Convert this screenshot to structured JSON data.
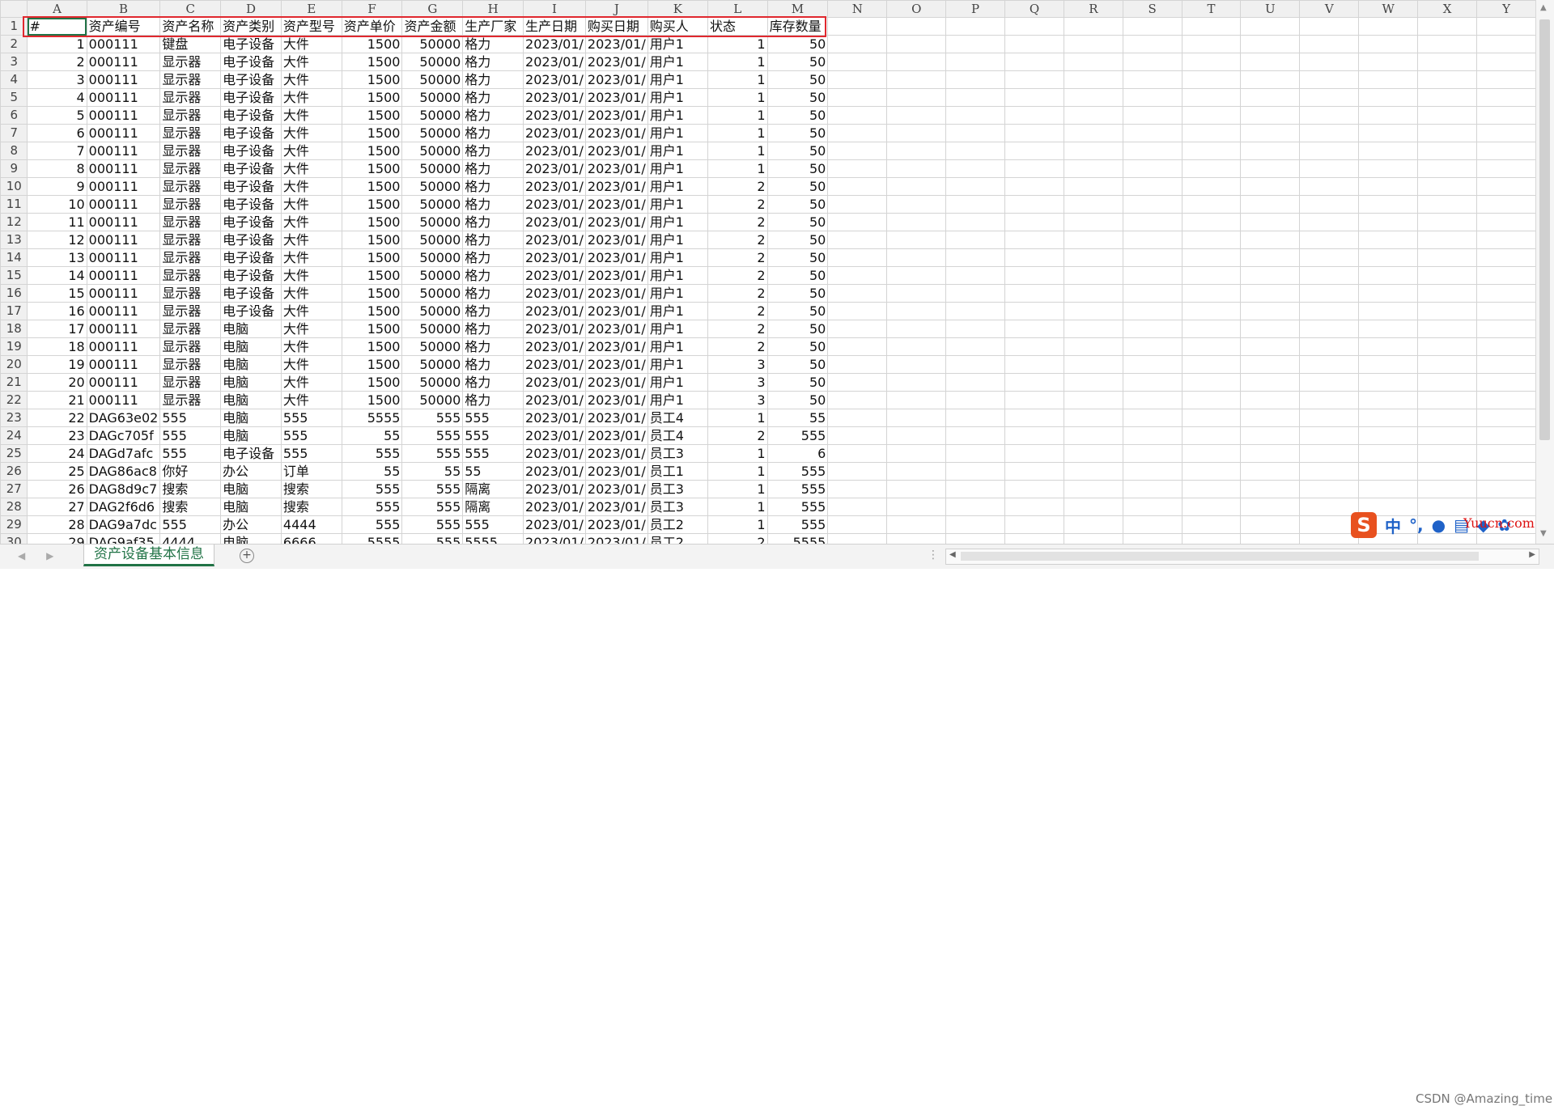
{
  "columns": [
    "A",
    "B",
    "C",
    "D",
    "E",
    "F",
    "G",
    "H",
    "I",
    "J",
    "K",
    "L",
    "M",
    "N",
    "O",
    "P",
    "Q",
    "R",
    "S",
    "T",
    "U",
    "V",
    "W",
    "X",
    "Y"
  ],
  "header_row": [
    "#",
    "资产编号",
    "资产名称",
    "资产类别",
    "资产型号",
    "资产单价",
    "资产金额",
    "生产厂家",
    "生产日期",
    "购买日期",
    "购买人",
    "状态",
    "库存数量"
  ],
  "rows": [
    [
      "1",
      "000111",
      "键盘",
      "电子设备",
      "大件",
      "1500",
      "50000",
      "格力",
      "2023/01/",
      "2023/01/",
      "用户1",
      "1",
      "50"
    ],
    [
      "2",
      "000111",
      "显示器",
      "电子设备",
      "大件",
      "1500",
      "50000",
      "格力",
      "2023/01/",
      "2023/01/",
      "用户1",
      "1",
      "50"
    ],
    [
      "3",
      "000111",
      "显示器",
      "电子设备",
      "大件",
      "1500",
      "50000",
      "格力",
      "2023/01/",
      "2023/01/",
      "用户1",
      "1",
      "50"
    ],
    [
      "4",
      "000111",
      "显示器",
      "电子设备",
      "大件",
      "1500",
      "50000",
      "格力",
      "2023/01/",
      "2023/01/",
      "用户1",
      "1",
      "50"
    ],
    [
      "5",
      "000111",
      "显示器",
      "电子设备",
      "大件",
      "1500",
      "50000",
      "格力",
      "2023/01/",
      "2023/01/",
      "用户1",
      "1",
      "50"
    ],
    [
      "6",
      "000111",
      "显示器",
      "电子设备",
      "大件",
      "1500",
      "50000",
      "格力",
      "2023/01/",
      "2023/01/",
      "用户1",
      "1",
      "50"
    ],
    [
      "7",
      "000111",
      "显示器",
      "电子设备",
      "大件",
      "1500",
      "50000",
      "格力",
      "2023/01/",
      "2023/01/",
      "用户1",
      "1",
      "50"
    ],
    [
      "8",
      "000111",
      "显示器",
      "电子设备",
      "大件",
      "1500",
      "50000",
      "格力",
      "2023/01/",
      "2023/01/",
      "用户1",
      "1",
      "50"
    ],
    [
      "9",
      "000111",
      "显示器",
      "电子设备",
      "大件",
      "1500",
      "50000",
      "格力",
      "2023/01/",
      "2023/01/",
      "用户1",
      "2",
      "50"
    ],
    [
      "10",
      "000111",
      "显示器",
      "电子设备",
      "大件",
      "1500",
      "50000",
      "格力",
      "2023/01/",
      "2023/01/",
      "用户1",
      "2",
      "50"
    ],
    [
      "11",
      "000111",
      "显示器",
      "电子设备",
      "大件",
      "1500",
      "50000",
      "格力",
      "2023/01/",
      "2023/01/",
      "用户1",
      "2",
      "50"
    ],
    [
      "12",
      "000111",
      "显示器",
      "电子设备",
      "大件",
      "1500",
      "50000",
      "格力",
      "2023/01/",
      "2023/01/",
      "用户1",
      "2",
      "50"
    ],
    [
      "13",
      "000111",
      "显示器",
      "电子设备",
      "大件",
      "1500",
      "50000",
      "格力",
      "2023/01/",
      "2023/01/",
      "用户1",
      "2",
      "50"
    ],
    [
      "14",
      "000111",
      "显示器",
      "电子设备",
      "大件",
      "1500",
      "50000",
      "格力",
      "2023/01/",
      "2023/01/",
      "用户1",
      "2",
      "50"
    ],
    [
      "15",
      "000111",
      "显示器",
      "电子设备",
      "大件",
      "1500",
      "50000",
      "格力",
      "2023/01/",
      "2023/01/",
      "用户1",
      "2",
      "50"
    ],
    [
      "16",
      "000111",
      "显示器",
      "电子设备",
      "大件",
      "1500",
      "50000",
      "格力",
      "2023/01/",
      "2023/01/",
      "用户1",
      "2",
      "50"
    ],
    [
      "17",
      "000111",
      "显示器",
      "电脑",
      "大件",
      "1500",
      "50000",
      "格力",
      "2023/01/",
      "2023/01/",
      "用户1",
      "2",
      "50"
    ],
    [
      "18",
      "000111",
      "显示器",
      "电脑",
      "大件",
      "1500",
      "50000",
      "格力",
      "2023/01/",
      "2023/01/",
      "用户1",
      "2",
      "50"
    ],
    [
      "19",
      "000111",
      "显示器",
      "电脑",
      "大件",
      "1500",
      "50000",
      "格力",
      "2023/01/",
      "2023/01/",
      "用户1",
      "3",
      "50"
    ],
    [
      "20",
      "000111",
      "显示器",
      "电脑",
      "大件",
      "1500",
      "50000",
      "格力",
      "2023/01/",
      "2023/01/",
      "用户1",
      "3",
      "50"
    ],
    [
      "21",
      "000111",
      "显示器",
      "电脑",
      "大件",
      "1500",
      "50000",
      "格力",
      "2023/01/",
      "2023/01/",
      "用户1",
      "3",
      "50"
    ],
    [
      "22",
      "DAG63e02",
      "555",
      "电脑",
      "555",
      "5555",
      "555",
      "555",
      "2023/01/",
      "2023/01/",
      "员工4",
      "1",
      "55"
    ],
    [
      "23",
      "DAGc705f",
      "555",
      "电脑",
      "555",
      "55",
      "555",
      "555",
      "2023/01/",
      "2023/01/",
      "员工4",
      "2",
      "555"
    ],
    [
      "24",
      "DAGd7afc",
      "555",
      "电子设备",
      "555",
      "555",
      "555",
      "555",
      "2023/01/",
      "2023/01/",
      "员工3",
      "1",
      "6"
    ],
    [
      "25",
      "DAG86ac8",
      "你好",
      "办公",
      "订单",
      "55",
      "55",
      "55",
      "2023/01/",
      "2023/01/",
      "员工1",
      "1",
      "555"
    ],
    [
      "26",
      "DAG8d9c7",
      "搜索",
      "电脑",
      "搜索",
      "555",
      "555",
      "隔离",
      "2023/01/",
      "2023/01/",
      "员工3",
      "1",
      "555"
    ],
    [
      "27",
      "DAG2f6d6",
      "搜索",
      "电脑",
      "搜索",
      "555",
      "555",
      "隔离",
      "2023/01/",
      "2023/01/",
      "员工3",
      "1",
      "555"
    ],
    [
      "28",
      "DAG9a7dc",
      "555",
      "办公",
      "4444",
      "555",
      "555",
      "555",
      "2023/01/",
      "2023/01/",
      "员工2",
      "1",
      "555"
    ],
    [
      "29",
      "DAG9af35",
      "4444",
      "电脑",
      "6666",
      "5555",
      "555",
      "5555",
      "2023/01/",
      "2023/01/",
      "员工2",
      "2",
      "5555"
    ]
  ],
  "sheet_tab": "资产设备基本信息",
  "add_sheet": "+",
  "ime": {
    "logo": "S",
    "lang": "中",
    "punct": "°,"
  },
  "watermark_top": "Yuucn.com",
  "watermark_bottom": "CSDN @Amazing_time",
  "colors": {
    "accent": "#217346",
    "highlight_box": "#e0282e"
  }
}
